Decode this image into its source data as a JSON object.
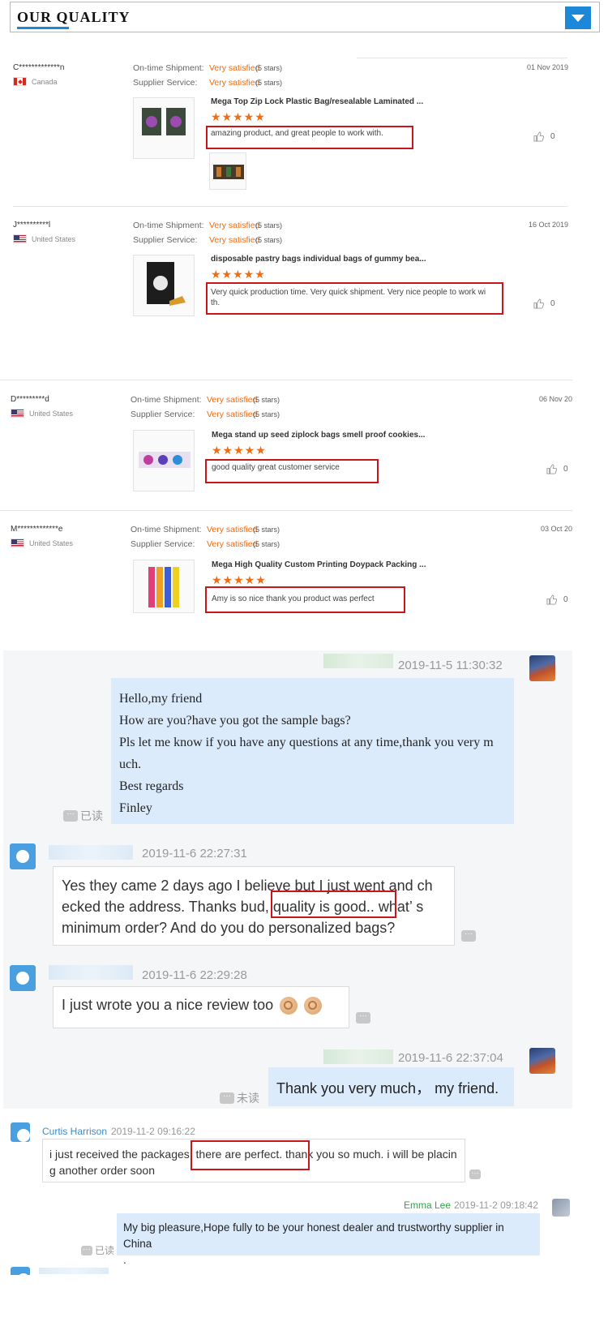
{
  "header": {
    "title": "OUR QUALITY"
  },
  "reviews": {
    "labels": {
      "shipment": "On-time Shipment:",
      "service": "Supplier Service:"
    },
    "items": [
      {
        "name": "C*************n",
        "country": "Canada",
        "shipment": "Very satisfied",
        "shipment_stars": "(5 stars)",
        "service": "Very satisfied",
        "service_stars": "(5 stars)",
        "date": "01 Nov 2019",
        "product": "Mega Top Zip Lock Plastic Bag/resealable Laminated ...",
        "stars": "★★★★★",
        "text_lines": [
          "amazing product, and great people to work with."
        ],
        "likes": "0"
      },
      {
        "name": "J**********l",
        "country": "United States",
        "shipment": "Very satisfied",
        "shipment_stars": "(5 stars)",
        "service": "Very satisfied",
        "service_stars": "(5 stars)",
        "date": "16 Oct 2019",
        "product": "disposable pastry bags individual bags of gummy bea...",
        "stars": "★★★★★",
        "text_lines": [
          "Very quick production time. Very quick shipment. Very nice people to work wi",
          "th."
        ],
        "likes": "0"
      },
      {
        "name": "D*********d",
        "country": "United States",
        "shipment": "Very satisfied",
        "shipment_stars": "(5 stars)",
        "service": "Very satisfied",
        "service_stars": "(5 stars)",
        "date": "06 Nov 20",
        "product": "Mega stand up seed ziplock bags smell proof cookies...",
        "stars": "★★★★★",
        "text_lines": [
          "good quality great customer service"
        ],
        "likes": "0"
      },
      {
        "name": "M*************e",
        "country": "United States",
        "shipment": "Very satisfied",
        "shipment_stars": "(5 stars)",
        "service": "Very satisfied",
        "service_stars": "(5 stars)",
        "date": "03 Oct 20",
        "product": "Mega High Quality Custom Printing Doypack Packing ...",
        "stars": "★★★★★",
        "text_lines": [
          "Amy is so nice thank you product was perfect"
        ],
        "likes": "0"
      }
    ]
  },
  "chat": {
    "msg1": {
      "time": "2019-11-5 11:30:32",
      "lines": [
        "Hello,my friend",
        "How are you?have you got the sample bags?",
        "Pls let me know if you have any questions at any time,thank you very m",
        "uch.",
        "Best regards",
        "Finley"
      ],
      "status": "已读"
    },
    "msg2": {
      "time": "2019-11-6 22:27:31",
      "lines": [
        "Yes they came 2 days ago I believe but I just went and ch",
        "ecked the address. Thanks bud, quality is good..  what’  s",
        " minimum order? And do you do personalized bags?"
      ]
    },
    "msg3": {
      "time": "2019-11-6 22:29:28",
      "text": "I just wrote you a nice review too"
    },
    "msg4": {
      "time": "2019-11-6 22:37:04",
      "text": "Thank you very much， my friend.",
      "status": "未读"
    },
    "msg5": {
      "sender": "Curtis Harrison",
      "time": "2019-11-2 09:16:22",
      "lines": [
        "i just received the packages, there are perfect. thank you so much. i will be placin",
        "g another order soon"
      ]
    },
    "msg6": {
      "sender": "Emma Lee",
      "time": "2019-11-2 09:18:42",
      "lines": [
        "My big pleasure,Hope fully to be your honest dealer and trustworthy supplier in China",
        "."
      ],
      "status": "已读"
    },
    "dots": "···"
  }
}
